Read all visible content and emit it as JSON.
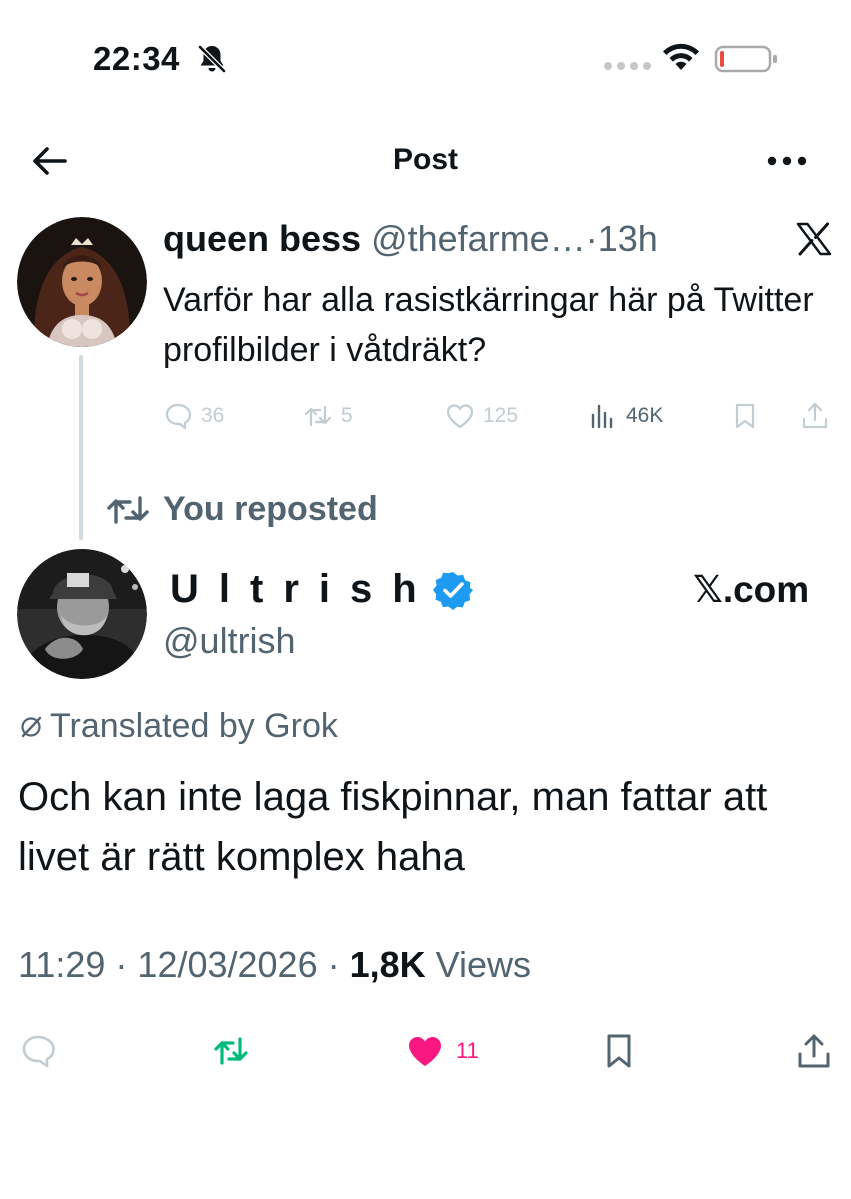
{
  "status_bar": {
    "time": "22:34",
    "icons": [
      "bell-slash-icon",
      "cellular-signal-icon",
      "wifi-icon",
      "battery-low-icon"
    ],
    "battery_level": 0.08,
    "battery_color": "#eb4d3d"
  },
  "nav": {
    "title": "Post",
    "back_icon": "arrow-left-icon",
    "more_icon": "more-horizontal-icon"
  },
  "parent_tweet": {
    "display_name": "queen bess",
    "handle": "@thefarme…",
    "separator": "·",
    "time_ago": "13h",
    "source_icon": "x-logo-icon",
    "text": "Varför har alla rasistkärringar här på Twitter profilbilder i våtdräkt?",
    "replies": "36",
    "reposts": "5",
    "likes": "125",
    "views": "46K"
  },
  "repost_banner": {
    "label": "You reposted"
  },
  "main_tweet": {
    "display_name": "Ultrish",
    "handle": "@ultrish",
    "verified": true,
    "source_label": ".com",
    "translated_label": "Translated by Grok",
    "text": "Och kan inte laga fiskpinnar, man fattar att livet är rätt komplex haha",
    "time": "11:29",
    "date": "12/03/2026",
    "views_count": "1,8K",
    "views_label": "Views",
    "likes": "11",
    "reposted": true,
    "liked": true
  },
  "colors": {
    "accent_blue": "#1d9bf0",
    "repost_green": "#00ba7c",
    "like_pink": "#f91880",
    "secondary_text": "#536471"
  }
}
